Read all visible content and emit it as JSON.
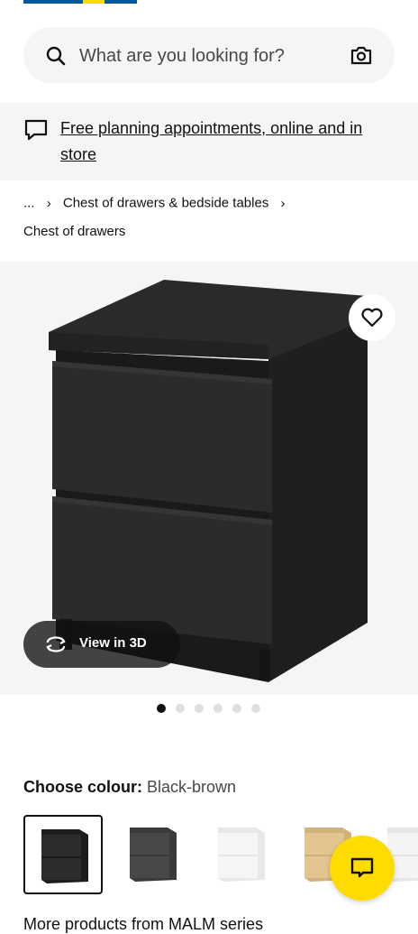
{
  "search": {
    "placeholder": "What are you looking for?"
  },
  "banner": {
    "link_text": "Free planning appointments, online and in store"
  },
  "breadcrumb": {
    "ellipsis": "...",
    "category": "Chest of drawers & bedside tables",
    "current": "Chest of drawers"
  },
  "gallery": {
    "view3d_label": "View in 3D",
    "dot_count": 6,
    "active_dot": 1
  },
  "colour": {
    "label": "Choose colour:",
    "value": "Black-brown",
    "swatches": [
      "black-brown",
      "black",
      "white",
      "white stained oak veneer",
      "white"
    ]
  },
  "bottom": {
    "text": "More products from MALM series"
  },
  "colors": {
    "ikea_blue": "#0058a3",
    "ikea_yellow": "#ffdb00",
    "surface_grey": "#f5f5f5"
  }
}
